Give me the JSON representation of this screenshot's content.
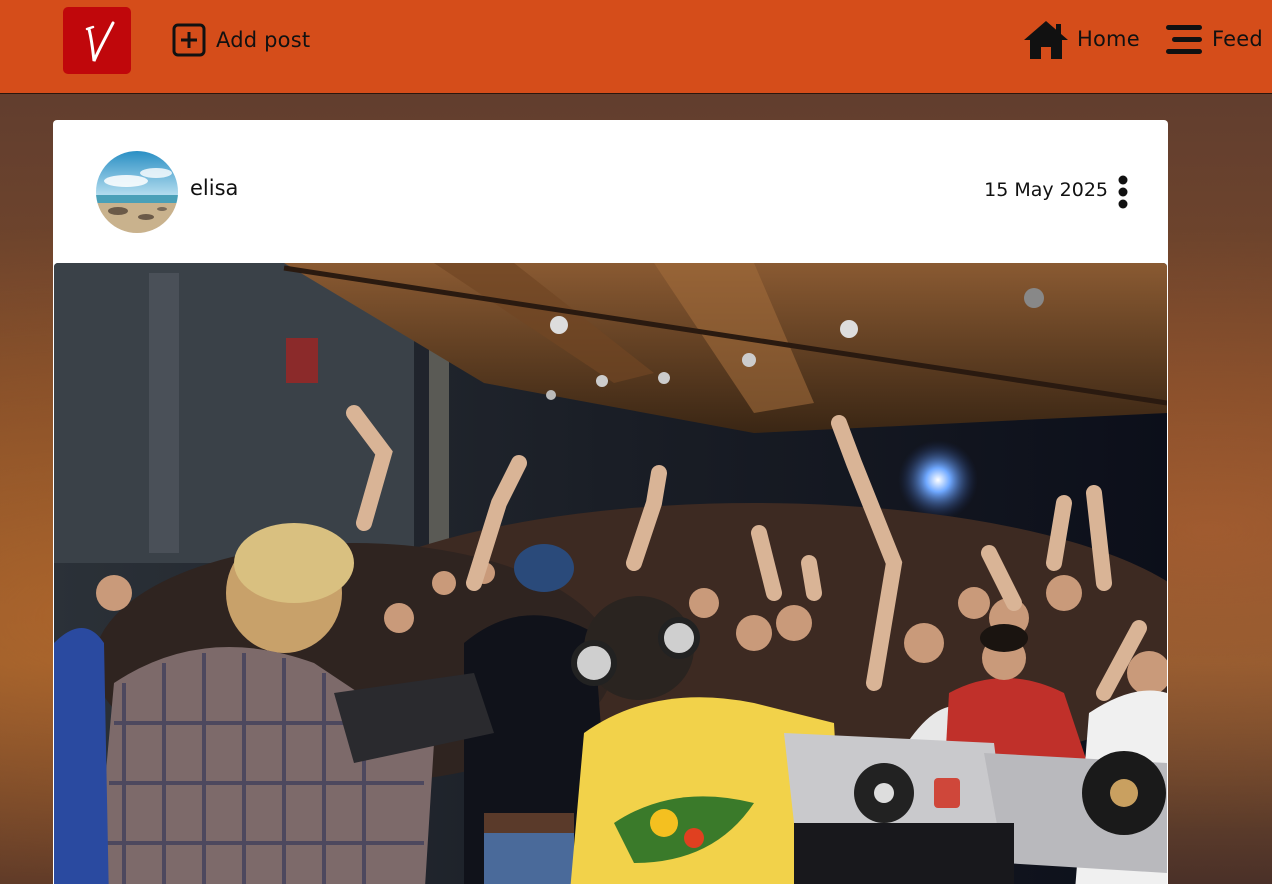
{
  "navbar": {
    "logo_letter": "V",
    "logo_bg": "#c0070b",
    "bar_color": "#d54d1a",
    "add_post": {
      "label": "Add post",
      "icon": "plus-square-icon"
    },
    "home": {
      "label": "Home",
      "icon": "home-icon"
    },
    "feed": {
      "label": "Feed",
      "icon": "menu-lines-icon"
    }
  },
  "post": {
    "author": "elisa",
    "date": "15 May 2025",
    "avatar_icon": "beach-landscape-avatar",
    "menu_icon": "vertical-dots-icon",
    "image_subject": "dj-party-crowd-photo"
  }
}
